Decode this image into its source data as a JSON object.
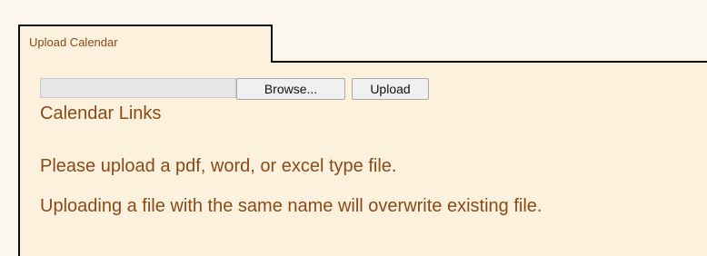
{
  "tab": {
    "label": "Upload Calendar"
  },
  "upload_form": {
    "file_field_value": "",
    "browse_label": "Browse...",
    "upload_label": "Upload"
  },
  "content": {
    "links_heading": "Calendar Links",
    "instruction_1": "Please upload a pdf, word, or excel type file.",
    "instruction_2": "Uploading a file with the same name will overwrite existing file."
  },
  "colors": {
    "background": "#fcf8ef",
    "panel": "#fcf1dc",
    "text": "#8a4a19",
    "border": "#111111"
  }
}
